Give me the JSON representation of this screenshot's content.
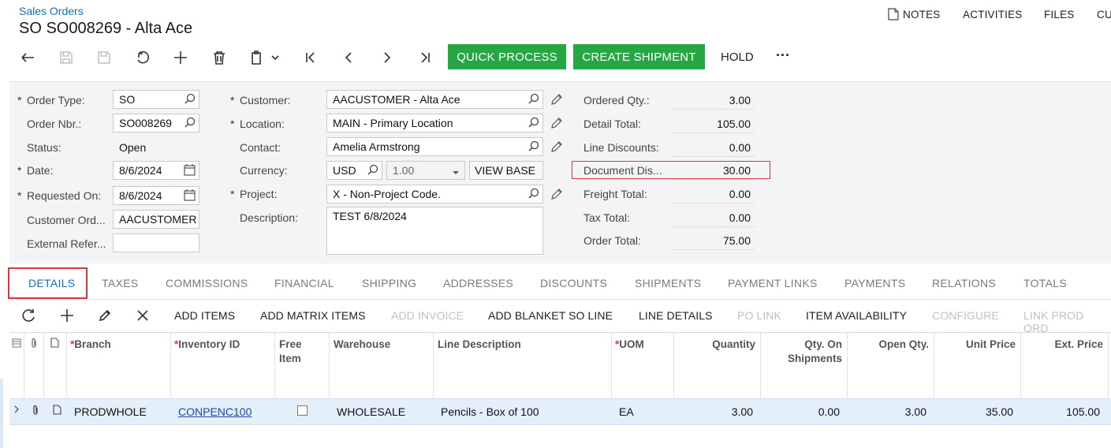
{
  "breadcrumb": "Sales Orders",
  "page_title": "SO SO008269 - Alta Ace",
  "top_nav": {
    "notes": "NOTES",
    "activities": "ACTIVITIES",
    "files": "FILES",
    "cu": "CU"
  },
  "toolbar": {
    "quick_process": "QUICK PROCESS",
    "create_shipment": "CREATE SHIPMENT",
    "hold": "HOLD",
    "more": "···"
  },
  "form": {
    "order_type": {
      "label": "Order Type:",
      "value": "SO"
    },
    "order_nbr": {
      "label": "Order Nbr.:",
      "value": "SO008269"
    },
    "status": {
      "label": "Status:",
      "value": "Open"
    },
    "date": {
      "label": "Date:",
      "value": "8/6/2024"
    },
    "requested_on": {
      "label": "Requested On:",
      "value": "8/6/2024"
    },
    "customer_ord": {
      "label": "Customer Ord...",
      "value": "AACUSTOMER"
    },
    "external_ref": {
      "label": "External Refer...",
      "value": ""
    },
    "customer": {
      "label": "Customer:",
      "value": "AACUSTOMER - Alta Ace"
    },
    "location": {
      "label": "Location:",
      "value": "MAIN - Primary Location"
    },
    "contact": {
      "label": "Contact:",
      "value": "Amelia Armstrong"
    },
    "currency": {
      "label": "Currency:",
      "value": "USD",
      "rate": "1.00",
      "view_base": "VIEW BASE"
    },
    "project": {
      "label": "Project:",
      "value": "X - Non-Project Code."
    },
    "description": {
      "label": "Description:",
      "value": "TEST 6/8/2024"
    }
  },
  "totals": [
    {
      "label": "Ordered Qty.:",
      "value": "3.00"
    },
    {
      "label": "Detail Total:",
      "value": "105.00"
    },
    {
      "label": "Line Discounts:",
      "value": "0.00"
    },
    {
      "label": "Document Dis...",
      "value": "30.00"
    },
    {
      "label": "Freight Total:",
      "value": "0.00"
    },
    {
      "label": "Tax Total:",
      "value": "0.00"
    },
    {
      "label": "Order Total:",
      "value": "75.00"
    }
  ],
  "tabs": [
    "DETAILS",
    "TAXES",
    "COMMISSIONS",
    "FINANCIAL",
    "SHIPPING",
    "ADDRESSES",
    "DISCOUNTS",
    "SHIPMENTS",
    "PAYMENT LINKS",
    "PAYMENTS",
    "RELATIONS",
    "TOTALS"
  ],
  "grid_toolbar": [
    "ADD ITEMS",
    "ADD MATRIX ITEMS",
    "ADD INVOICE",
    "ADD BLANKET SO LINE",
    "LINE DETAILS",
    "PO LINK",
    "ITEM AVAILABILITY",
    "CONFIGURE",
    "LINK PROD ORD"
  ],
  "columns": [
    "Branch",
    "Inventory ID",
    "Free Item",
    "Warehouse",
    "Line Description",
    "UOM",
    "Quantity",
    "Qty. On Shipments",
    "Open Qty.",
    "Unit Price",
    "Ext. Price"
  ],
  "rows": [
    {
      "branch": "PRODWHOLE",
      "inventory_id": "CONPENC100",
      "free_item": false,
      "warehouse": "WHOLESALE",
      "line_description": "Pencils - Box of 100",
      "uom": "EA",
      "quantity": "3.00",
      "qty_on_shipments": "0.00",
      "open_qty": "3.00",
      "unit_price": "35.00",
      "ext_price": "105.00"
    }
  ],
  "colors": {
    "accent": "#1a6fb0",
    "green": "#27a744",
    "highlight": "#d9363e"
  }
}
